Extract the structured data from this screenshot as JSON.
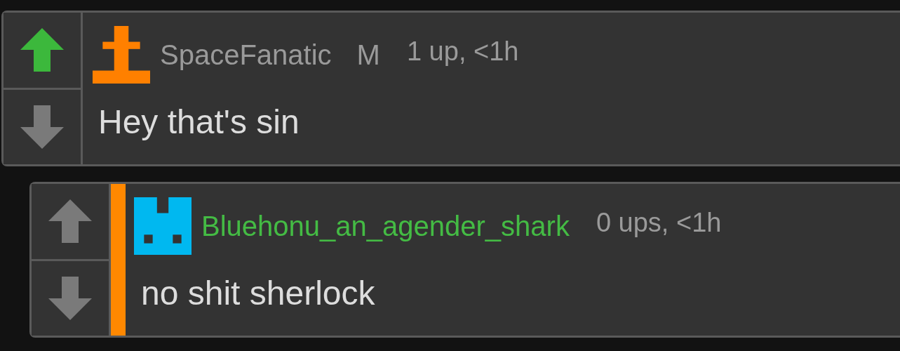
{
  "comments": [
    {
      "reply": false,
      "upvoted": true,
      "downvoted": false,
      "avatar": {
        "kind": "cross",
        "color": "#ff8000"
      },
      "username": {
        "text": "SpaceFanatic",
        "color": "#9a9a9a"
      },
      "badge": "M",
      "meta": "1 up, <1h",
      "text": "Hey that's sin"
    },
    {
      "reply": true,
      "upvoted": false,
      "downvoted": false,
      "avatar": {
        "kind": "castle",
        "color": "#00b8f0"
      },
      "username": {
        "text": "Bluehonu_an_agender_shark",
        "color": "#44bb44"
      },
      "meta": "0 ups, <1h",
      "text": "no shit sherlock"
    }
  ]
}
